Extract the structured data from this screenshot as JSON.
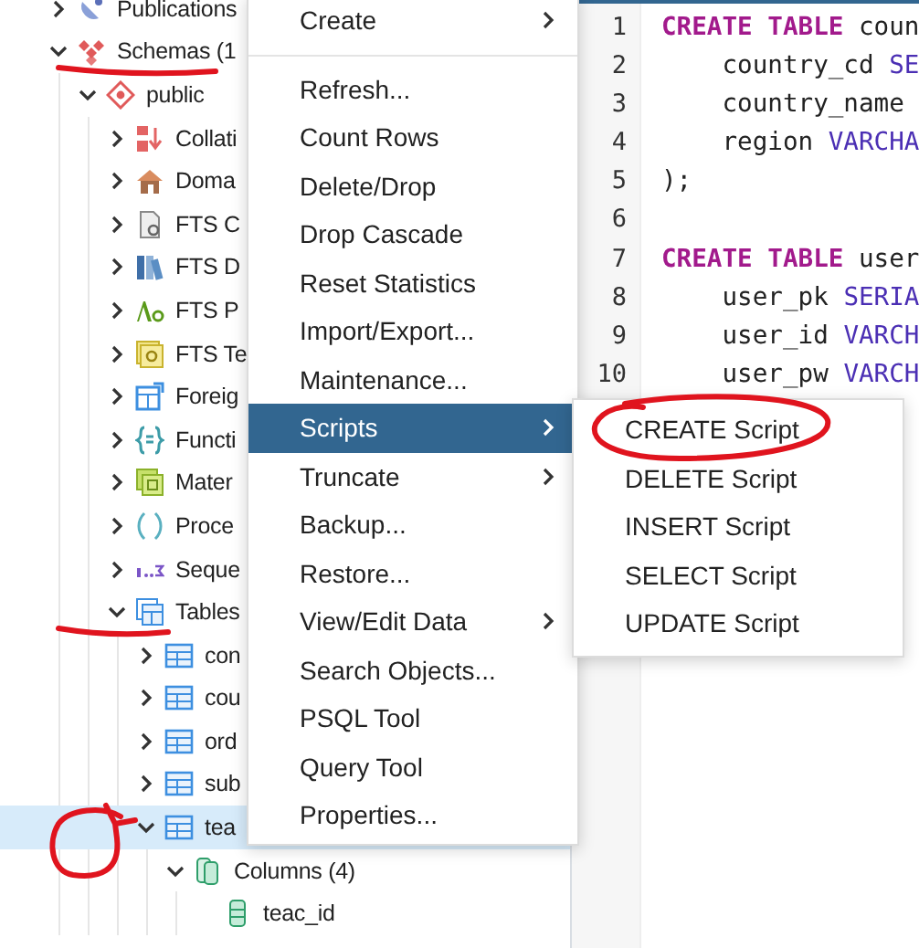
{
  "tree": [
    {
      "label": "Publications",
      "kind": "publication",
      "expanded": false,
      "selected": false
    },
    {
      "label": "Schemas (1",
      "kind": "schemas",
      "expanded": true,
      "selected": false,
      "underlined": true,
      "children": [
        {
          "label": "public",
          "kind": "schema",
          "expanded": true,
          "selected": false,
          "children": [
            {
              "label": "Collati",
              "kind": "collation",
              "expanded": false,
              "selected": false
            },
            {
              "label": "Doma",
              "kind": "domain",
              "expanded": false,
              "selected": false
            },
            {
              "label": "FTS C",
              "kind": "fts-config",
              "expanded": false,
              "selected": false
            },
            {
              "label": "FTS D",
              "kind": "fts-dict",
              "expanded": false,
              "selected": false
            },
            {
              "label": "FTS P",
              "kind": "fts-parser",
              "expanded": false,
              "selected": false
            },
            {
              "label": "FTS Te",
              "kind": "fts-template",
              "expanded": false,
              "selected": false
            },
            {
              "label": "Foreig",
              "kind": "foreign",
              "expanded": false,
              "selected": false
            },
            {
              "label": "Functi",
              "kind": "function",
              "expanded": false,
              "selected": false
            },
            {
              "label": "Mater",
              "kind": "mview",
              "expanded": false,
              "selected": false
            },
            {
              "label": "Proce",
              "kind": "procedure",
              "expanded": false,
              "selected": false
            },
            {
              "label": "Seque",
              "kind": "sequence",
              "expanded": false,
              "selected": false
            },
            {
              "label": "Tables",
              "kind": "tables",
              "expanded": true,
              "selected": false,
              "underlined": true,
              "children": [
                {
                  "label": "con",
                  "kind": "table",
                  "expanded": false,
                  "selected": false
                },
                {
                  "label": "cou",
                  "kind": "table",
                  "expanded": false,
                  "selected": false
                },
                {
                  "label": "ord",
                  "kind": "table",
                  "expanded": false,
                  "selected": false
                },
                {
                  "label": "sub",
                  "kind": "table",
                  "expanded": false,
                  "selected": false
                },
                {
                  "label": "tea",
                  "kind": "table",
                  "expanded": true,
                  "selected": true,
                  "circled": true,
                  "children": [
                    {
                      "label": "Columns (4)",
                      "kind": "columns",
                      "expanded": true,
                      "selected": false,
                      "children": [
                        {
                          "label": "teac_id",
                          "kind": "column",
                          "selected": false
                        }
                      ]
                    }
                  ]
                }
              ]
            }
          ]
        }
      ]
    }
  ],
  "context_menu": {
    "groups": [
      [
        {
          "label": "Create",
          "submenu": true,
          "selected": false
        }
      ],
      [
        {
          "label": "Refresh...",
          "submenu": false,
          "selected": false
        },
        {
          "label": "Count Rows",
          "submenu": false,
          "selected": false
        },
        {
          "label": "Delete/Drop",
          "submenu": false,
          "selected": false
        },
        {
          "label": "Drop Cascade",
          "submenu": false,
          "selected": false
        },
        {
          "label": "Reset Statistics",
          "submenu": false,
          "selected": false
        },
        {
          "label": "Import/Export...",
          "submenu": false,
          "selected": false
        },
        {
          "label": "Maintenance...",
          "submenu": false,
          "selected": false
        },
        {
          "label": "Scripts",
          "submenu": true,
          "selected": true
        },
        {
          "label": "Truncate",
          "submenu": true,
          "selected": false
        },
        {
          "label": "Backup...",
          "submenu": false,
          "selected": false
        },
        {
          "label": "Restore...",
          "submenu": false,
          "selected": false
        },
        {
          "label": "View/Edit Data",
          "submenu": true,
          "selected": false
        },
        {
          "label": "Search Objects...",
          "submenu": false,
          "selected": false
        },
        {
          "label": "PSQL Tool",
          "submenu": false,
          "selected": false
        },
        {
          "label": "Query Tool",
          "submenu": false,
          "selected": false
        },
        {
          "label": "Properties...",
          "submenu": false,
          "selected": false
        }
      ]
    ]
  },
  "submenu": [
    {
      "label": "CREATE Script",
      "selected": false,
      "circled": true
    },
    {
      "label": "DELETE Script",
      "selected": false
    },
    {
      "label": "INSERT Script",
      "selected": false
    },
    {
      "label": "SELECT Script",
      "selected": false
    },
    {
      "label": "UPDATE Script",
      "selected": false
    }
  ],
  "editor": {
    "lines": [
      {
        "number": "1",
        "tokens": [
          {
            "kind": "keyword",
            "text": "CREATE TABLE"
          },
          {
            "kind": "plain",
            "text": " coun"
          }
        ]
      },
      {
        "number": "2",
        "tokens": [
          {
            "kind": "plain",
            "text": "    country_cd "
          },
          {
            "kind": "type",
            "text": "SE"
          }
        ]
      },
      {
        "number": "3",
        "tokens": [
          {
            "kind": "plain",
            "text": "    country_name"
          }
        ]
      },
      {
        "number": "4",
        "tokens": [
          {
            "kind": "plain",
            "text": "    region "
          },
          {
            "kind": "type",
            "text": "VARCHA"
          }
        ]
      },
      {
        "number": "5",
        "tokens": [
          {
            "kind": "plain",
            "text": ");"
          }
        ]
      },
      {
        "number": "6"
      },
      {
        "number": "7",
        "tokens": [
          {
            "kind": "keyword",
            "text": "CREATE TABLE"
          },
          {
            "kind": "plain",
            "text": " user"
          }
        ]
      },
      {
        "number": "8",
        "tokens": [
          {
            "kind": "plain",
            "text": "    user_pk "
          },
          {
            "kind": "type",
            "text": "SERIA"
          }
        ]
      },
      {
        "number": "9",
        "tokens": [
          {
            "kind": "plain",
            "text": "    user_id "
          },
          {
            "kind": "type",
            "text": "VARCH"
          }
        ]
      },
      {
        "number": "10",
        "tokens": [
          {
            "kind": "plain",
            "text": "    user_pw "
          },
          {
            "kind": "type",
            "text": "VARCH"
          }
        ]
      }
    ]
  }
}
